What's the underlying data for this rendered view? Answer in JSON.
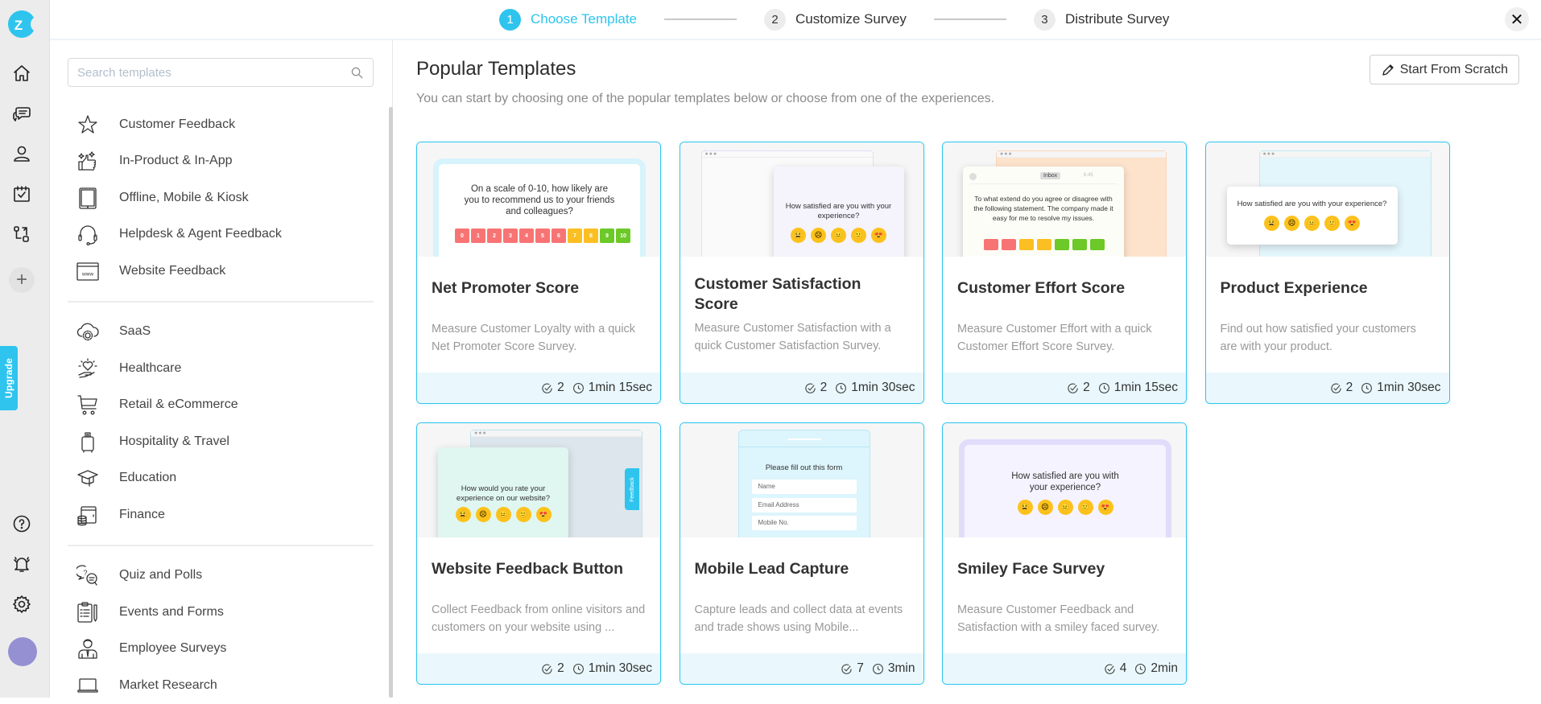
{
  "rail": {
    "logo_letter": "Z",
    "items": [
      {
        "icon": "home-icon"
      },
      {
        "icon": "chat-feedback-icon"
      },
      {
        "icon": "user-icon"
      },
      {
        "icon": "calendar-check-icon"
      },
      {
        "icon": "workflow-icon"
      }
    ],
    "add_label": "+",
    "upgrade_label": "Upgrade",
    "bottom_items": [
      {
        "icon": "help-icon"
      },
      {
        "icon": "bell-icon"
      },
      {
        "icon": "settings-icon"
      }
    ]
  },
  "stepper": {
    "steps": [
      {
        "number": "1",
        "label": "Choose Template",
        "active": true
      },
      {
        "number": "2",
        "label": "Customize Survey",
        "active": false
      },
      {
        "number": "3",
        "label": "Distribute Survey",
        "active": false
      }
    ],
    "close_label": "✕"
  },
  "sidebar": {
    "search_placeholder": "Search templates",
    "search_value": "",
    "groups": [
      [
        {
          "label": "Customer Feedback",
          "icon": "star-icon"
        },
        {
          "label": "In-Product & In-App",
          "icon": "thumbs-up-sparkle-icon"
        },
        {
          "label": "Offline, Mobile & Kiosk",
          "icon": "tablet-icon"
        },
        {
          "label": "Helpdesk & Agent Feedback",
          "icon": "headset-icon"
        },
        {
          "label": "Website Feedback",
          "icon": "browser-www-icon"
        }
      ],
      [
        {
          "label": "SaaS",
          "icon": "cloud-gear-icon"
        },
        {
          "label": "Healthcare",
          "icon": "heart-hand-icon"
        },
        {
          "label": "Retail & eCommerce",
          "icon": "cart-icon"
        },
        {
          "label": "Hospitality & Travel",
          "icon": "luggage-icon"
        },
        {
          "label": "Education",
          "icon": "graduation-cap-icon"
        },
        {
          "label": "Finance",
          "icon": "wallet-coins-icon"
        }
      ],
      [
        {
          "label": "Quiz and Polls",
          "icon": "quiz-bubbles-icon"
        },
        {
          "label": "Events and Forms",
          "icon": "clipboard-icon"
        },
        {
          "label": "Employee Surveys",
          "icon": "employee-icon"
        },
        {
          "label": "Market Research",
          "icon": "laptop-icon"
        }
      ]
    ]
  },
  "main": {
    "title": "Popular Templates",
    "subtitle": "You can start by choosing one of the popular templates below or choose from one of the experiences.",
    "scratch_button": "Start From Scratch",
    "templates": [
      {
        "title": "Net Promoter Score",
        "description": "Measure Customer Loyalty with a quick Net Promoter Score Survey.",
        "questions": "2",
        "duration": "1min 15sec",
        "preview": {
          "question": "On a scale of 0-10, how likely are you to recommend us to your friends and colleagues?",
          "scale": [
            "0",
            "1",
            "2",
            "3",
            "4",
            "5",
            "6",
            "7",
            "8",
            "9",
            "10"
          ]
        }
      },
      {
        "title": "Customer Satisfaction Score",
        "description": "Measure Customer Satisfaction with a quick Customer Satisfaction Survey.",
        "questions": "2",
        "duration": "1min 30sec",
        "preview": {
          "question": "How satisfied are you with your experience?"
        }
      },
      {
        "title": "Customer Effort Score",
        "description": "Measure Customer Effort with a quick Customer Effort Score Survey.",
        "questions": "2",
        "duration": "1min 15sec",
        "preview": {
          "inbox_tag": "Inbox",
          "time": "6:45",
          "question": "To what extend do you agree or disagree with the following statement. The company made it easy for me to resolve my issues."
        }
      },
      {
        "title": "Product Experience",
        "description": "Find out how satisfied your customers are with your product.",
        "questions": "2",
        "duration": "1min 30sec",
        "preview": {
          "question": "How satisfied are you with your experience?"
        }
      },
      {
        "title": "Website Feedback Button",
        "description": "Collect Feedback from online visitors and customers on your website using ...",
        "questions": "2",
        "duration": "1min 30sec",
        "preview": {
          "question": "How would you rate your experience on our website?",
          "tab_label": "Feedback"
        }
      },
      {
        "title": "Mobile Lead Capture",
        "description": "Capture leads and collect data at events and trade shows using Mobile...",
        "questions": "7",
        "duration": "3min",
        "preview": {
          "question": "Please fill out this form",
          "fields": [
            "Name",
            "Email Address",
            "Mobile No."
          ]
        }
      },
      {
        "title": "Smiley Face Survey",
        "description": "Measure Customer Feedback and Satisfaction with a smiley faced survey.",
        "questions": "4",
        "duration": "2min",
        "preview": {
          "question": "How satisfied are you with your experience?"
        }
      }
    ],
    "emojis": [
      "😫",
      "☹",
      "😐",
      "🙂",
      "😍"
    ]
  },
  "colors": {
    "accent": "#2ec4ee",
    "rail_bg": "#ececec",
    "card_footer": "#eaf8fd",
    "avatar": "#9490d2",
    "nps_red": "#f87474",
    "nps_yellow": "#fbbf24",
    "nps_green": "#6cc928"
  }
}
